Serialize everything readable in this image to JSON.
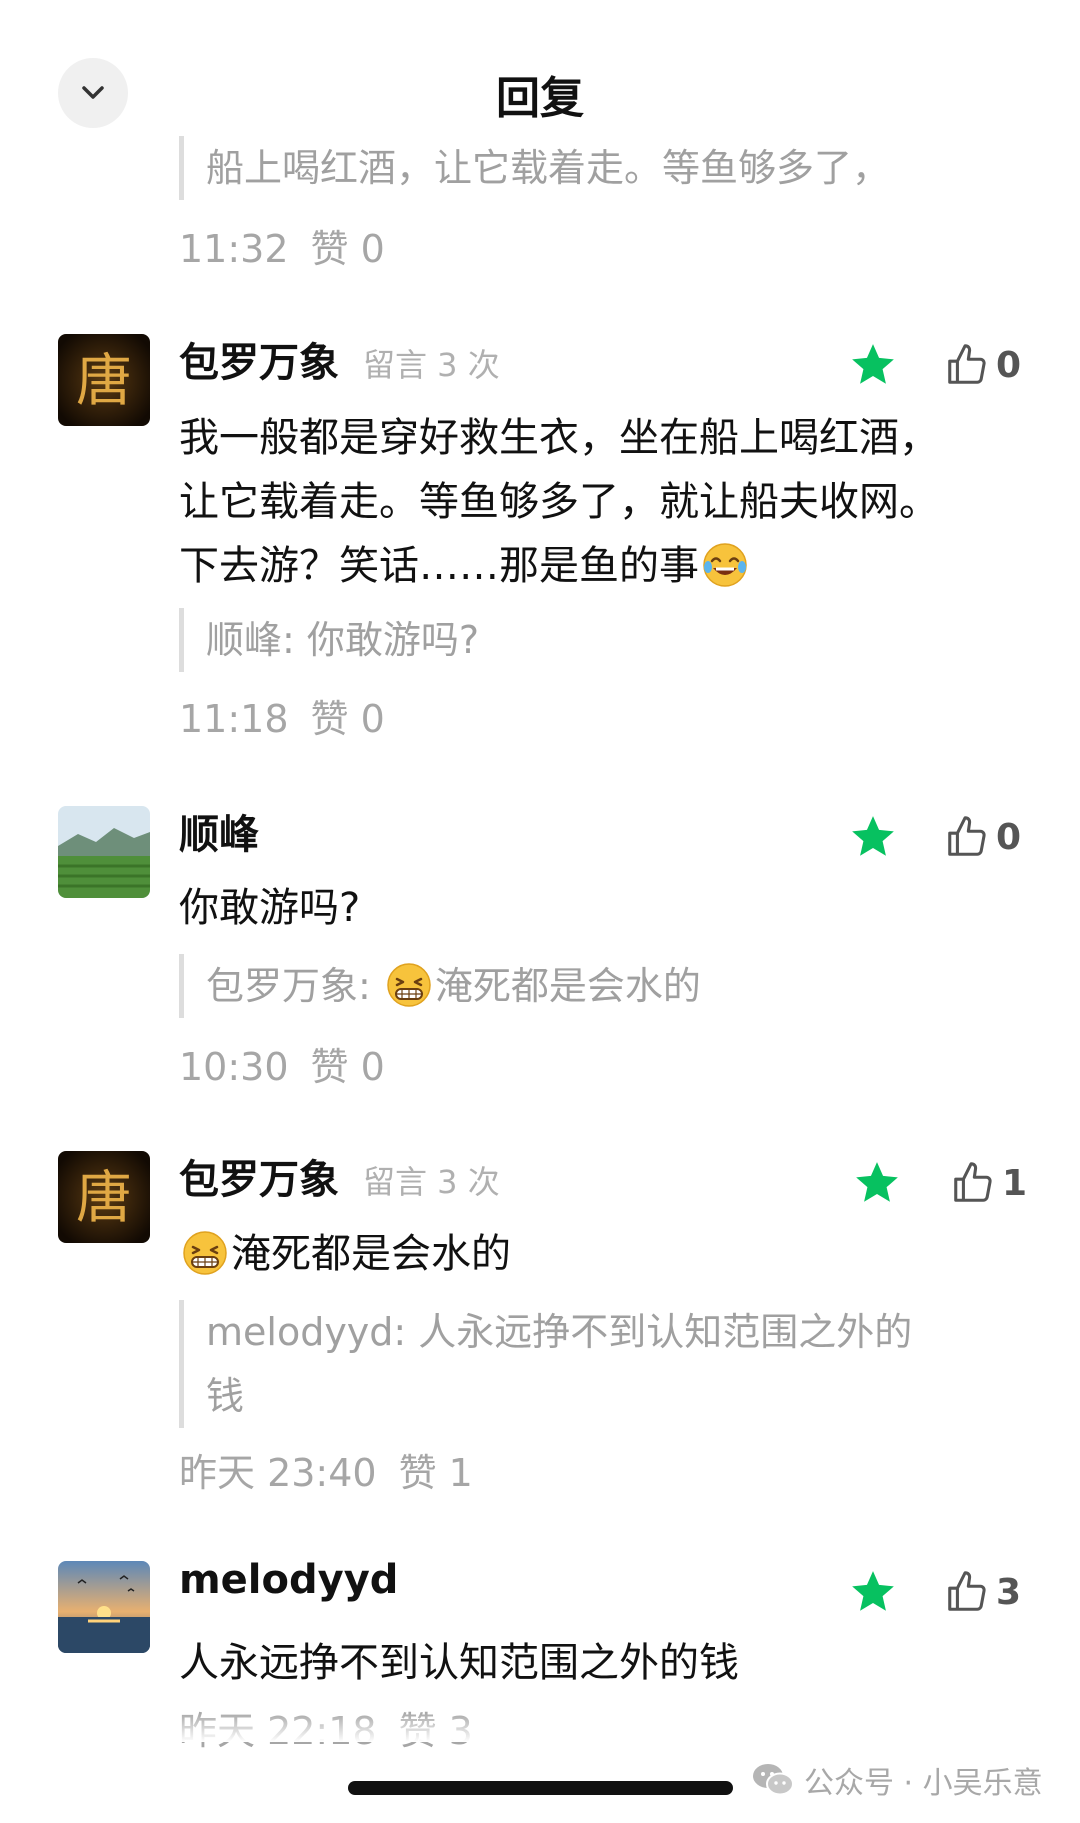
{
  "header": {
    "title": "回复",
    "collapse_icon": "chevron-down-icon"
  },
  "top_fragment": {
    "quote": "船上喝红酒，让它载着走。等鱼够多了，",
    "time": "11:32",
    "likes_text": "赞 0"
  },
  "comments": [
    {
      "author": "包罗万象",
      "badge": "留言 3 次",
      "avatar": "tang-character-avatar",
      "text_lines": [
        "我一般都是穿好救生衣，坐在船上喝红酒，",
        "让它载着走。等鱼够多了，就让船夫收网。",
        "下去游？笑话……那是鱼的事"
      ],
      "trailing_emoji": "laughing-tears-emoji",
      "quote": "顺峰: 你敢游吗?",
      "time": "11:18",
      "likes_text": "赞 0",
      "like_count": "0",
      "starred": true
    },
    {
      "author": "顺峰",
      "avatar": "landscape-avatar",
      "text": "你敢游吗?",
      "quote_prefix": "包罗万象: ",
      "quote_emoji": "grinning-emoji",
      "quote_text": "淹死都是会水的",
      "time": "10:30",
      "likes_text": "赞 0",
      "like_count": "0",
      "starred": true
    },
    {
      "author": "包罗万象",
      "badge": "留言 3 次",
      "avatar": "tang-character-avatar",
      "leading_emoji": "grinning-emoji",
      "text": "淹死都是会水的",
      "quote_lines": [
        "melodyyd: 人永远挣不到认知范围之外的",
        "钱"
      ],
      "time": "昨天 23:40",
      "likes_text": "赞 1",
      "like_count": "1",
      "starred": true
    },
    {
      "author": "melodyyd",
      "avatar": "sunset-avatar",
      "text": "人永远挣不到认知范围之外的钱",
      "time": "昨天 22:18",
      "likes_text": "赞 3",
      "like_count": "3",
      "starred": true
    }
  ],
  "watermark": {
    "text": "公众号 · 小吴乐意",
    "icon": "wechat-icon"
  },
  "colors": {
    "star": "#07c160",
    "meta_gray": "#a6a6a6",
    "quote_bar": "#dddddd"
  }
}
